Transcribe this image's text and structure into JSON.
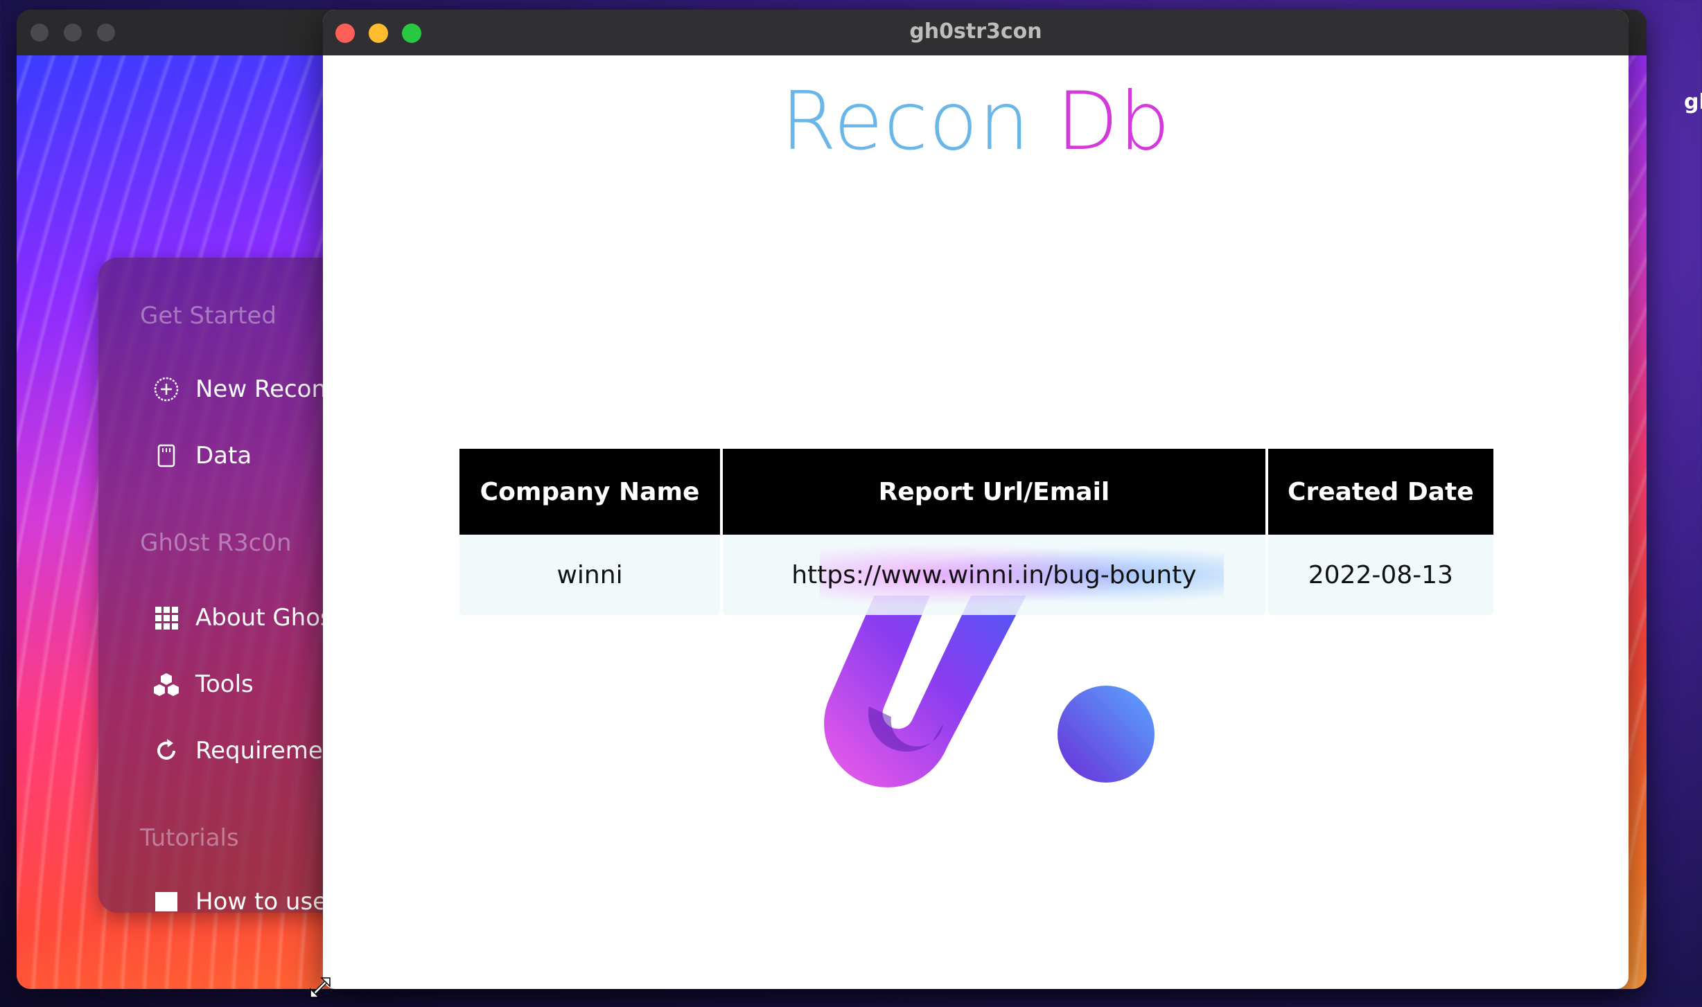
{
  "desktop": {
    "right_edge_text": "gl"
  },
  "back_window": {
    "sidebar": {
      "sections": [
        {
          "heading": "Get Started"
        },
        {
          "heading": "Gh0st R3c0n"
        },
        {
          "heading": "Tutorials"
        }
      ],
      "items": [
        {
          "label": "New Recon",
          "icon": "plus-circle-icon"
        },
        {
          "label": "Data",
          "icon": "sd-card-icon"
        },
        {
          "label": "About Ghost",
          "icon": "grid-icon"
        },
        {
          "label": "Tools",
          "icon": "boxes-icon"
        },
        {
          "label": "Requirement",
          "icon": "refresh-icon"
        },
        {
          "label": "How to use V",
          "icon": "film-icon"
        }
      ]
    }
  },
  "front_window": {
    "title": "gh0str3con",
    "page": {
      "title_part1": "Recon",
      "title_part2": "Db"
    },
    "table": {
      "columns": [
        "Company Name",
        "Report Url/Email",
        "Created Date"
      ],
      "rows": [
        [
          "winni",
          "https://www.winni.in/bug-bounty",
          "2022-08-13"
        ]
      ]
    }
  },
  "colors": {
    "title_blue": "#6ab6e6",
    "title_magenta": "#d23ad9",
    "traffic_red": "#ff5f57",
    "traffic_yellow": "#febc2e",
    "traffic_green": "#28c840"
  }
}
